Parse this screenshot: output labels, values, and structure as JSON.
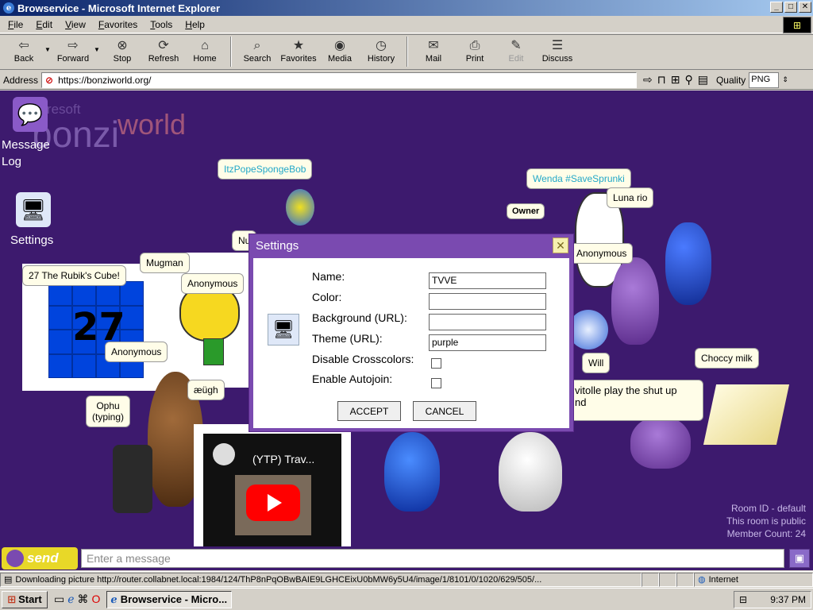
{
  "window": {
    "title": "Browservice - Microsoft Internet Explorer",
    "min": "_",
    "max": "□",
    "close": "✕"
  },
  "menu": [
    "File",
    "Edit",
    "View",
    "Favorites",
    "Tools",
    "Help"
  ],
  "toolbar": {
    "back": "Back",
    "forward": "Forward",
    "stop": "Stop",
    "refresh": "Refresh",
    "home": "Home",
    "search": "Search",
    "favorites": "Favorites",
    "media": "Media",
    "history": "History",
    "mail": "Mail",
    "print": "Print",
    "edit": "Edit",
    "discuss": "Discuss"
  },
  "address": {
    "label": "Address",
    "url": "https://bonziworld.org/",
    "quality_label": "Quality",
    "quality_value": "PNG"
  },
  "page": {
    "logo_small": "ueresoft",
    "logo_bonzi": "bonzi",
    "logo_world": "world",
    "sidebar": {
      "message_log": "Message\nLog",
      "settings": "Settings"
    },
    "bubbles": {
      "itzpope": "ItzPopeSpongeBob",
      "wenda": "Wenda #SaveSprunki",
      "luna": "Luna rio",
      "owner": "Owner",
      "anon_right": "Anonymous",
      "mugman": "Mugman",
      "rubik": "27 The Rubik's Cube!",
      "anon_cat": "Anonymous",
      "anon_cube": "Anonymous",
      "aeugh": "æügh",
      "ophu": "Ophu\n(typing)",
      "will": "Will",
      "choccy": "Choccy milk",
      "vitolle": "vitolle play the shut up\nnd",
      "nu": "Nu"
    },
    "cube_number": "27",
    "video_title": "(YTP) Trav...",
    "room": {
      "id": "Room ID - default",
      "public": "This room is public",
      "members": "Member Count: 24"
    }
  },
  "settings": {
    "title": "Settings",
    "close": "✕",
    "fields": {
      "name_label": "Name:",
      "name_value": "TVVE",
      "color_label": "Color:",
      "color_value": "",
      "bg_label": "Background (URL):",
      "bg_value": "",
      "theme_label": "Theme (URL):",
      "theme_value": "purple",
      "crosscolors_label": "Disable Crosscolors:",
      "autojoin_label": "Enable Autojoin:"
    },
    "accept": "ACCEPT",
    "cancel": "CANCEL"
  },
  "chat": {
    "send": "send",
    "placeholder": "Enter a message"
  },
  "status": {
    "text": "Downloading picture http://router.collabnet.local:1984/124/ThP8nPqOBwBAIE9LGHCEixU0bMW6y5U4/image/1/8101/0/1020/629/505/...",
    "zone": "Internet"
  },
  "taskbar": {
    "start": "Start",
    "task": "Browservice - Micro...",
    "time": "9:37 PM"
  },
  "colors": {
    "page_bg": "#3d1a6e",
    "dialog": "#7a4ab0",
    "send": "#e8d828"
  }
}
